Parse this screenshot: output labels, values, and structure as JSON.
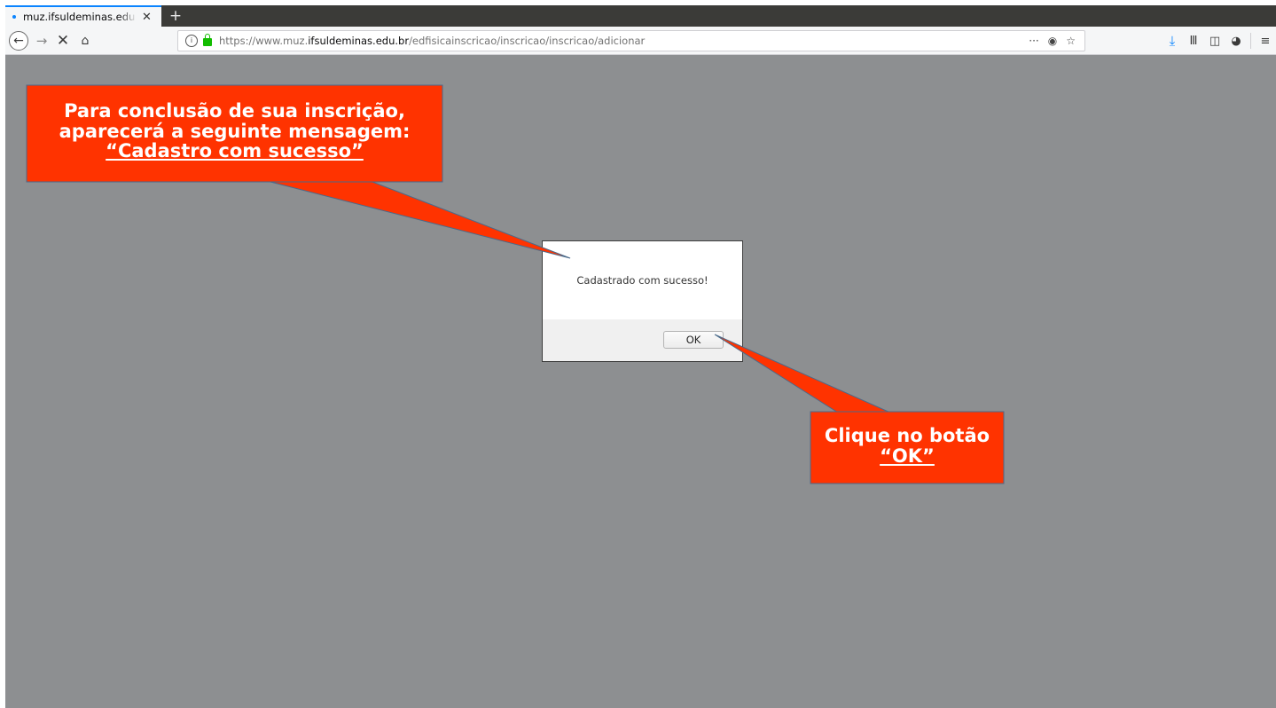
{
  "browser": {
    "tab": {
      "title": "muz.ifsuldeminas.edu.b",
      "close_glyph": "✕"
    },
    "new_tab_glyph": "+",
    "nav": {
      "back_glyph": "←",
      "forward_glyph": "→",
      "stop_glyph": "✕",
      "home_glyph": "⌂"
    },
    "url": {
      "prefix": "https://www.muz.",
      "domain": "ifsuldeminas.edu.br",
      "path": "/edfisicainscricao/inscricao/inscricao/adicionar",
      "page_actions_glyph": "···",
      "pocket_glyph": "◉",
      "bookmark_glyph": "☆"
    },
    "toolbar": {
      "downloads_glyph": "⤓",
      "library_glyph": "Ⅲ",
      "sidebar_glyph": "◫",
      "extension_glyph": "◕",
      "menu_glyph": "≡"
    }
  },
  "dialog": {
    "message": "Cadastrado com sucesso!",
    "ok_label": "OK"
  },
  "annotations": {
    "callout1": {
      "line1": "Para conclusão de sua inscrição,",
      "line2": "aparecerá a seguinte mensagem:",
      "line3": "“Cadastro com sucesso”"
    },
    "callout2": {
      "line1": "Clique no botão",
      "line2": "“OK”"
    },
    "fill_color": "#ff3300",
    "border_color": "#4a6a8a"
  },
  "colors": {
    "overlay": "#8d8f91",
    "tab_accent": "#0a84ff",
    "secure_lock": "#12bc00"
  }
}
